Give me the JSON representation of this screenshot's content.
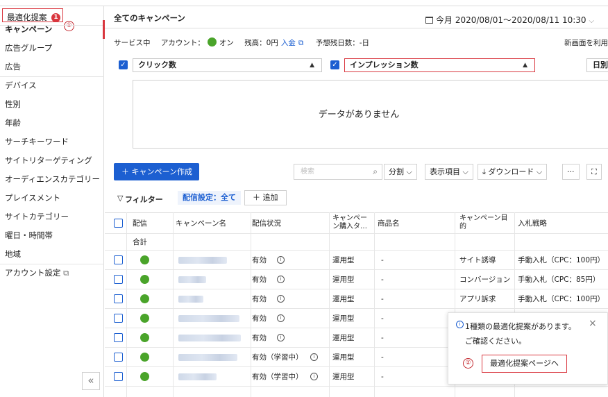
{
  "sidebar": {
    "optimization": {
      "label": "最適化提案",
      "badge": "1"
    },
    "markers": {
      "one": "①",
      "two": "②"
    },
    "items": [
      {
        "label": "キャンペーン",
        "active": true
      },
      {
        "label": "広告グループ"
      },
      {
        "label": "広告"
      },
      {
        "label": "デバイス"
      },
      {
        "label": "性別"
      },
      {
        "label": "年齢"
      },
      {
        "label": "サーチキーワード"
      },
      {
        "label": "サイトリターゲティング"
      },
      {
        "label": "オーディエンスカテゴリー"
      },
      {
        "label": "プレイスメント"
      },
      {
        "label": "サイトカテゴリー"
      },
      {
        "label": "曜日・時間帯"
      },
      {
        "label": "地域"
      },
      {
        "label": "アカウント設定"
      }
    ],
    "collapse_icon": "«"
  },
  "header": {
    "title": "全てのキャンペーン",
    "date_range": "今月 2020/08/01〜2020/08/11 10:30"
  },
  "account": {
    "status": "サービス中",
    "account_label": "アカウント：",
    "account_state": "オン",
    "balance_label": "残高：0円",
    "deposit": "入金",
    "remaining_days": "予想残日数：-日",
    "new_screen": "新画面を利用"
  },
  "metrics": {
    "metric1": "クリック数",
    "metric2": "インプレッション数",
    "period": "日別",
    "no_data": "データがありません"
  },
  "toolbar": {
    "create": "＋ キャンペーン作成",
    "search_placeholder": "検索",
    "split": "分割",
    "columns": "表示項目",
    "download": "ダウンロード",
    "more": "···",
    "expand": "⛶"
  },
  "filter": {
    "label": "フィルター",
    "pill": "配信設定：全て",
    "add": "＋ 追加"
  },
  "table": {
    "headers": {
      "delivery": "配信",
      "name": "キャンペーン名",
      "status": "配信状況",
      "purchase": "キャンペー\nン購入タ…",
      "product": "商品名",
      "goal": "キャンペーン目\n的",
      "bidding": "入札戦略"
    },
    "total_label": "合計",
    "rows": [
      {
        "status": "有効",
        "type": "運用型",
        "product": "-",
        "goal": "サイト誘導",
        "bid": "手動入札（CPC：100円）",
        "blurw": 70
      },
      {
        "status": "有効",
        "type": "運用型",
        "product": "-",
        "goal": "コンバージョン",
        "bid": "手動入札（CPC：85円）",
        "blurw": 40
      },
      {
        "status": "有効",
        "type": "運用型",
        "product": "-",
        "goal": "アプリ訴求",
        "bid": "手動入札（CPC：100円）",
        "blurw": 36
      },
      {
        "status": "有効",
        "type": "運用型",
        "product": "-",
        "goal": "",
        "bid": "",
        "blurw": 88
      },
      {
        "status": "有効",
        "type": "運用型",
        "product": "-",
        "goal": "",
        "bid": "",
        "blurw": 90
      },
      {
        "status": "有効（学習中）",
        "type": "運用型",
        "product": "-",
        "goal": "",
        "bid": "",
        "blurw": 85
      },
      {
        "status": "有効（学習中）",
        "type": "運用型",
        "product": "-",
        "goal": "",
        "bid": "",
        "blurw": 55
      }
    ]
  },
  "popup": {
    "line1": "1種類の最適化提案があります。",
    "line2": "ご確認ください。",
    "button": "最適化提案ページへ",
    "close": "×"
  }
}
